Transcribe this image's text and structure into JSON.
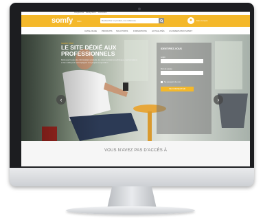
{
  "top_links": [
    "Google Plus",
    "Somfy Store",
    "Connexion"
  ],
  "header": {
    "logo": "somfy",
    "logo_tagline": "PRO",
    "search_placeholder": "Rechercher un produit, une référence",
    "account_label": "Mon compte"
  },
  "nav": [
    "CATALOGUE",
    "PRODUITS",
    "SOLUTIONS",
    "FORMATIONS",
    "ACTUALITÉS",
    "L'UNIVERS PRO SOMFY"
  ],
  "hero": {
    "tag": "SOMFY PRO",
    "title": "LE SITE DÉDIÉ AUX PROFESSIONNELS",
    "text": "Retrouvez toutes les informations produits, les documentations techniques, les formations et les outils pour accompagner vos projets au quotidien."
  },
  "login": {
    "title": "IDENTIFIEZ-VOUS",
    "login_label": "Login",
    "password_label": "Mot de passe",
    "remember_label": "Se souvenir de moi",
    "submit_label": "SE CONNECTER"
  },
  "arrows": {
    "prev": "‹",
    "next": "›"
  },
  "section_title": "VOUS N'AVEZ PAS D'ACCÈS À",
  "icons": {
    "search": "search-icon",
    "account": "user-icon"
  },
  "colors": {
    "brand": "#f4b82a",
    "monitor": "#1c1d20"
  }
}
